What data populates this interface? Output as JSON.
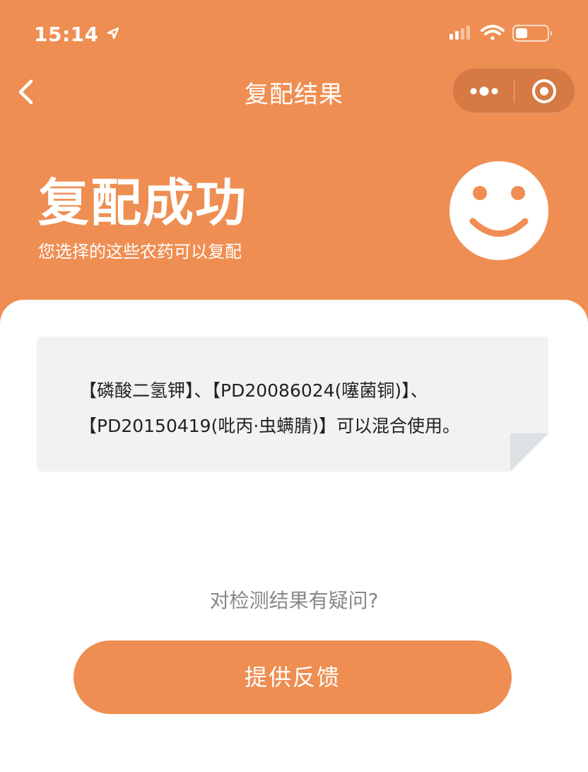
{
  "status_bar": {
    "time": "15:14",
    "location_icon": "location-arrow-icon",
    "signal_icon": "signal-icon",
    "wifi_icon": "wifi-icon",
    "battery_icon": "battery-icon"
  },
  "nav": {
    "title": "复配结果",
    "back_icon": "back-chevron-icon",
    "more_icon": "more-dots-icon",
    "close_icon": "target-close-icon"
  },
  "result": {
    "title": "复配成功",
    "subtitle": "您选择的这些农药可以复配",
    "icon": "smiley-face-icon"
  },
  "note": {
    "lines": [
      "【磷酸二氢钾】、【PD20086024(噻菌铜)】、",
      "【PD20150419(吡丙·虫螨腈)】可以混合使用。"
    ]
  },
  "feedback": {
    "question": "对检测结果有疑问?",
    "button_label": "提供反馈"
  },
  "colors": {
    "accent": "#EF8E52",
    "card_bg": "#F0F2F3",
    "text_muted": "#888888"
  }
}
